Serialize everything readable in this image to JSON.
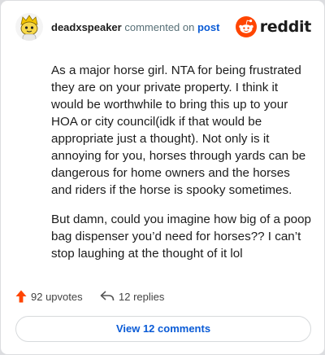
{
  "comment": {
    "author": "deadxspeaker",
    "action_text": "commented on",
    "post_link": "post",
    "paragraphs": [
      "As a major horse girl. NTA for being frustrated they are on your private property. I think it would be worthwhile to bring this up to your HOA or city council(idk if that would be appropriate just a thought). Not only is it annoying for you, horses through yards can be dangerous for home owners and the horses and riders if the horse is spooky sometimes.",
      "But damn, could you imagine how big of a poop bag dispenser you’d need for horses?? I can’t stop laughing at the thought of it lol"
    ],
    "upvotes": "92 upvotes",
    "replies": "12 replies",
    "view_button": "View 12 comments"
  },
  "brand": {
    "name": "reddit",
    "color": "#ff4500"
  },
  "colors": {
    "link": "#0a5bd6",
    "upvote": "#ff4500"
  },
  "icons": {
    "avatar": "snoo-avatar-yellow-hat",
    "upvote": "upvote-arrow-icon",
    "reply": "reply-arrow-icon",
    "logo": "reddit-snoo-icon"
  }
}
